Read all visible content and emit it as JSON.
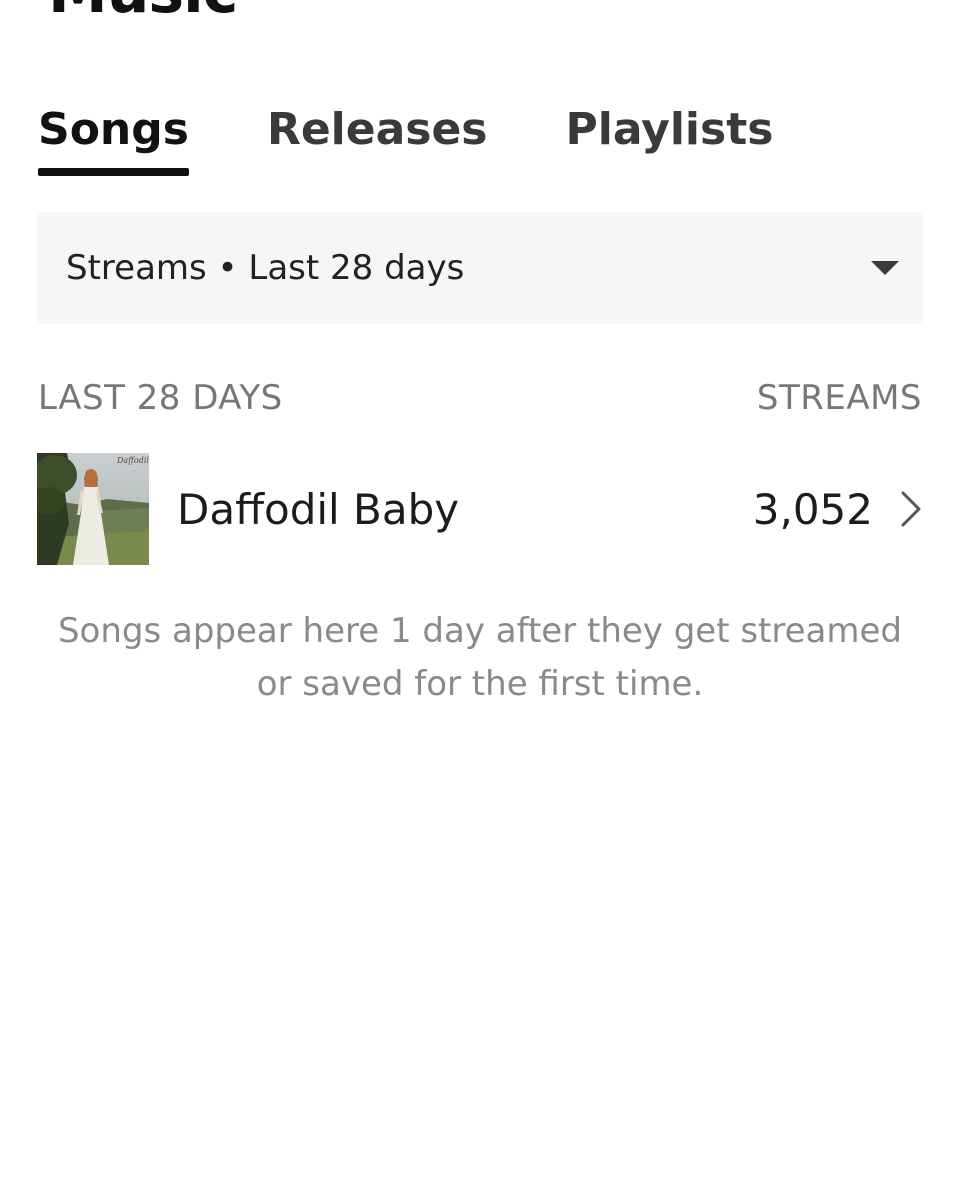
{
  "header": {
    "title": "Music"
  },
  "tabs": [
    {
      "label": "Songs",
      "active": true
    },
    {
      "label": "Releases",
      "active": false
    },
    {
      "label": "Playlists",
      "active": false
    }
  ],
  "filter": {
    "label": "Streams • Last 28 days",
    "icon": "caret-down-icon"
  },
  "list": {
    "period_header": "LAST 28 DAYS",
    "metric_header": "STREAMS",
    "items": [
      {
        "title": "Daffodil Baby",
        "streams": "3,052",
        "cover_text": "Daffodil Baby",
        "icon": "chevron-right-icon"
      }
    ]
  },
  "hint": {
    "line1": "Songs appear here 1 day after they get streamed",
    "line2": "or saved for the first time."
  },
  "colors": {
    "tab_underline": "#111111",
    "filter_background": "#f6f6f6",
    "muted_text": "#777777",
    "hint_text": "#8a8a8a"
  }
}
